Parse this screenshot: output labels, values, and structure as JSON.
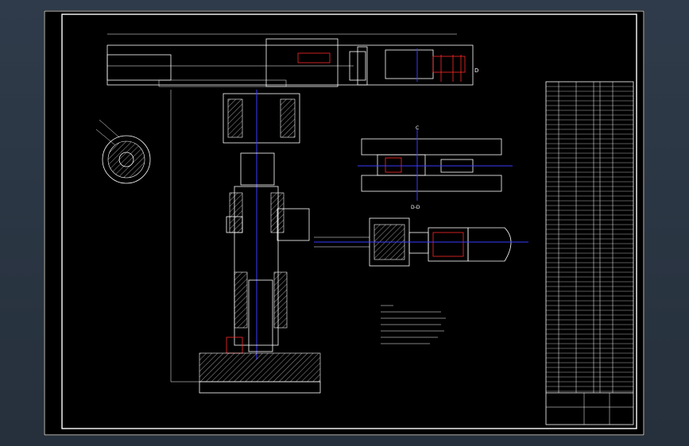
{
  "drawing": {
    "section_label": "D-D",
    "dimension_c": "C",
    "dimension_d": "D"
  },
  "colors": {
    "background": "#2b3644",
    "sheet": "#000000",
    "line": "#ffffff",
    "accent_red": "#ff2a2a",
    "accent_blue": "#3a3aff"
  }
}
